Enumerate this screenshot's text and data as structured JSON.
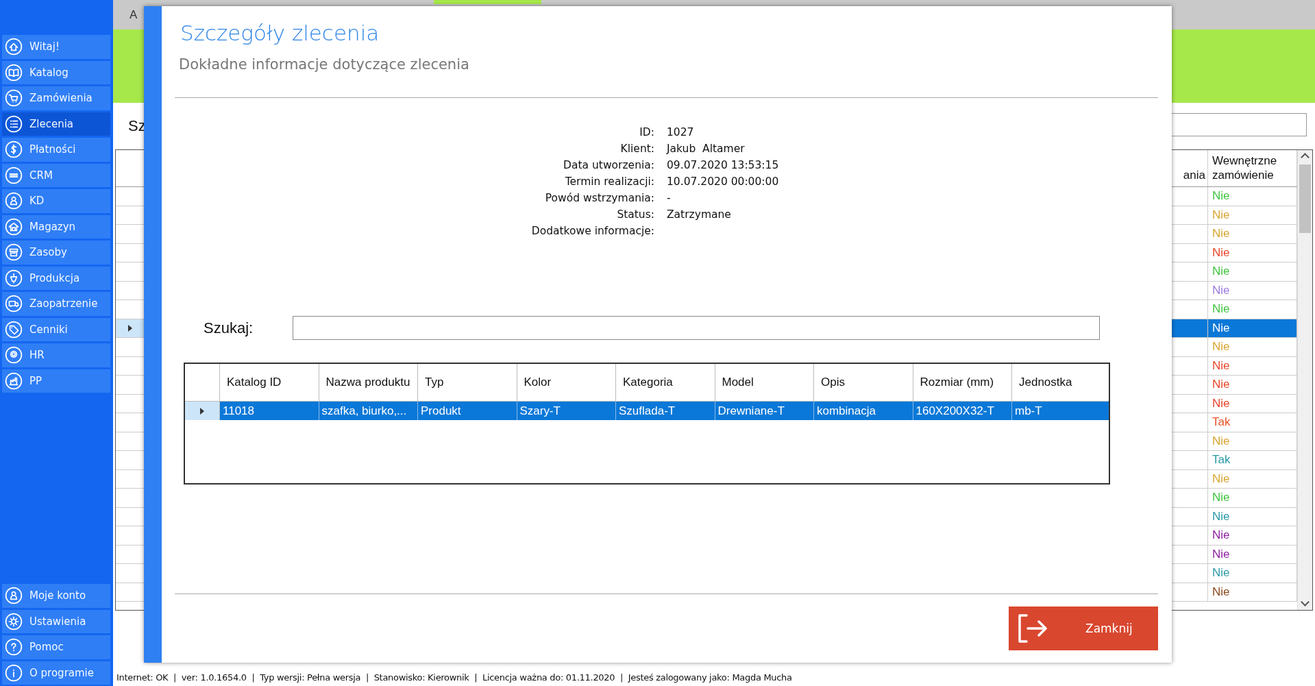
{
  "sidebar": {
    "items": [
      {
        "label": "Witaj!",
        "selected": false
      },
      {
        "label": "Katalog",
        "selected": false
      },
      {
        "label": "Zamówienia",
        "selected": false
      },
      {
        "label": "Zlecenia",
        "selected": true
      },
      {
        "label": "Płatności",
        "selected": false
      },
      {
        "label": "CRM",
        "selected": false
      },
      {
        "label": "KD",
        "selected": false
      },
      {
        "label": "Magazyn",
        "selected": false
      },
      {
        "label": "Zasoby",
        "selected": false
      },
      {
        "label": "Produkcja",
        "selected": false
      },
      {
        "label": "Zaopatrzenie",
        "selected": false
      },
      {
        "label": "Cenniki",
        "selected": false
      },
      {
        "label": "HR",
        "selected": false
      },
      {
        "label": "PP",
        "selected": false
      }
    ],
    "bottom_items": [
      {
        "label": "Moje konto"
      },
      {
        "label": "Ustawienia"
      },
      {
        "label": "Pomoc"
      },
      {
        "label": "O programie"
      }
    ]
  },
  "background": {
    "tab_label": "A",
    "search_label": "Sz",
    "table": {
      "columns": [
        "ania",
        "Wewnętrzne zamówienie"
      ],
      "rows": [
        {
          "value": "Nie",
          "color": "#3fc43f",
          "selected": false
        },
        {
          "value": "Nie",
          "color": "#d9a531",
          "selected": false
        },
        {
          "value": "Nie",
          "color": "#d9a531",
          "selected": false
        },
        {
          "value": "Nie",
          "color": "#e8472a",
          "selected": false
        },
        {
          "value": "Nie",
          "color": "#3fc43f",
          "selected": false
        },
        {
          "value": "Nie",
          "color": "#9b7be0",
          "selected": false
        },
        {
          "value": "Nie",
          "color": "#3fc43f",
          "selected": false
        },
        {
          "value": "Nie",
          "selected": true
        },
        {
          "value": "Nie",
          "color": "#d9a531",
          "selected": false
        },
        {
          "value": "Nie",
          "color": "#e8472a",
          "selected": false
        },
        {
          "value": "Nie",
          "color": "#e8472a",
          "selected": false
        },
        {
          "value": "Nie",
          "color": "#e8472a",
          "selected": false
        },
        {
          "value": "Tak",
          "color": "#e8552a",
          "selected": false
        },
        {
          "value": "Nie",
          "color": "#d9a531",
          "selected": false
        },
        {
          "value": "Tak",
          "color": "#2a9aa8",
          "selected": false
        },
        {
          "value": "Nie",
          "color": "#d9a531",
          "selected": false
        },
        {
          "value": "Nie",
          "color": "#3fc43f",
          "selected": false
        },
        {
          "value": "Nie",
          "color": "#2a9aa8",
          "selected": false
        },
        {
          "value": "Nie",
          "color": "#8e1fa0",
          "selected": false
        },
        {
          "value": "Nie",
          "color": "#8e1fa0",
          "selected": false
        },
        {
          "value": "Nie",
          "color": "#2a9aa8",
          "selected": false
        },
        {
          "value": "Nie",
          "color": "#8b4a1c",
          "selected": false
        }
      ]
    }
  },
  "dialog": {
    "title": "Szczegóły zlecenia",
    "subtitle": "Dokładne informacje dotyczące zlecenia",
    "details": [
      {
        "label": "ID:",
        "value": "1027"
      },
      {
        "label": "Klient:",
        "value": "Jakub  Altamer"
      },
      {
        "label": "Data utworzenia:",
        "value": "09.07.2020 13:53:15"
      },
      {
        "label": "Termin realizacji:",
        "value": "10.07.2020 00:00:00"
      },
      {
        "label": "Powód wstrzymania:",
        "value": "-"
      },
      {
        "label": "Status:",
        "value": "Zatrzymane"
      },
      {
        "label": "Dodatkowe informacje:"
      }
    ],
    "search": {
      "label": "Szukaj:"
    },
    "table": {
      "columns": [
        "Katalog ID",
        "Nazwa produktu",
        "Typ",
        "Kolor",
        "Kategoria",
        "Model",
        "Opis",
        "Rozmiar (mm)",
        "Jednostka"
      ],
      "rows": [
        {
          "cells": [
            "11018",
            "szafka, biurko,...",
            "Produkt",
            "Szary-T",
            "Szuflada-T",
            "Drewniane-T",
            "kombinacja",
            "160X200X32-T",
            "mb-T"
          ],
          "selected": true
        }
      ]
    },
    "close_button": "Zamknij"
  },
  "status_bar": "Internet: OK  |  ver: 1.0.1654.0  |  Typ wersji: Pełna wersja  |  Stanowisko: Kierownik  |  Licencja ważna do: 01.11.2020  |  Jesteś zalogowany jako: Magda Mucha"
}
